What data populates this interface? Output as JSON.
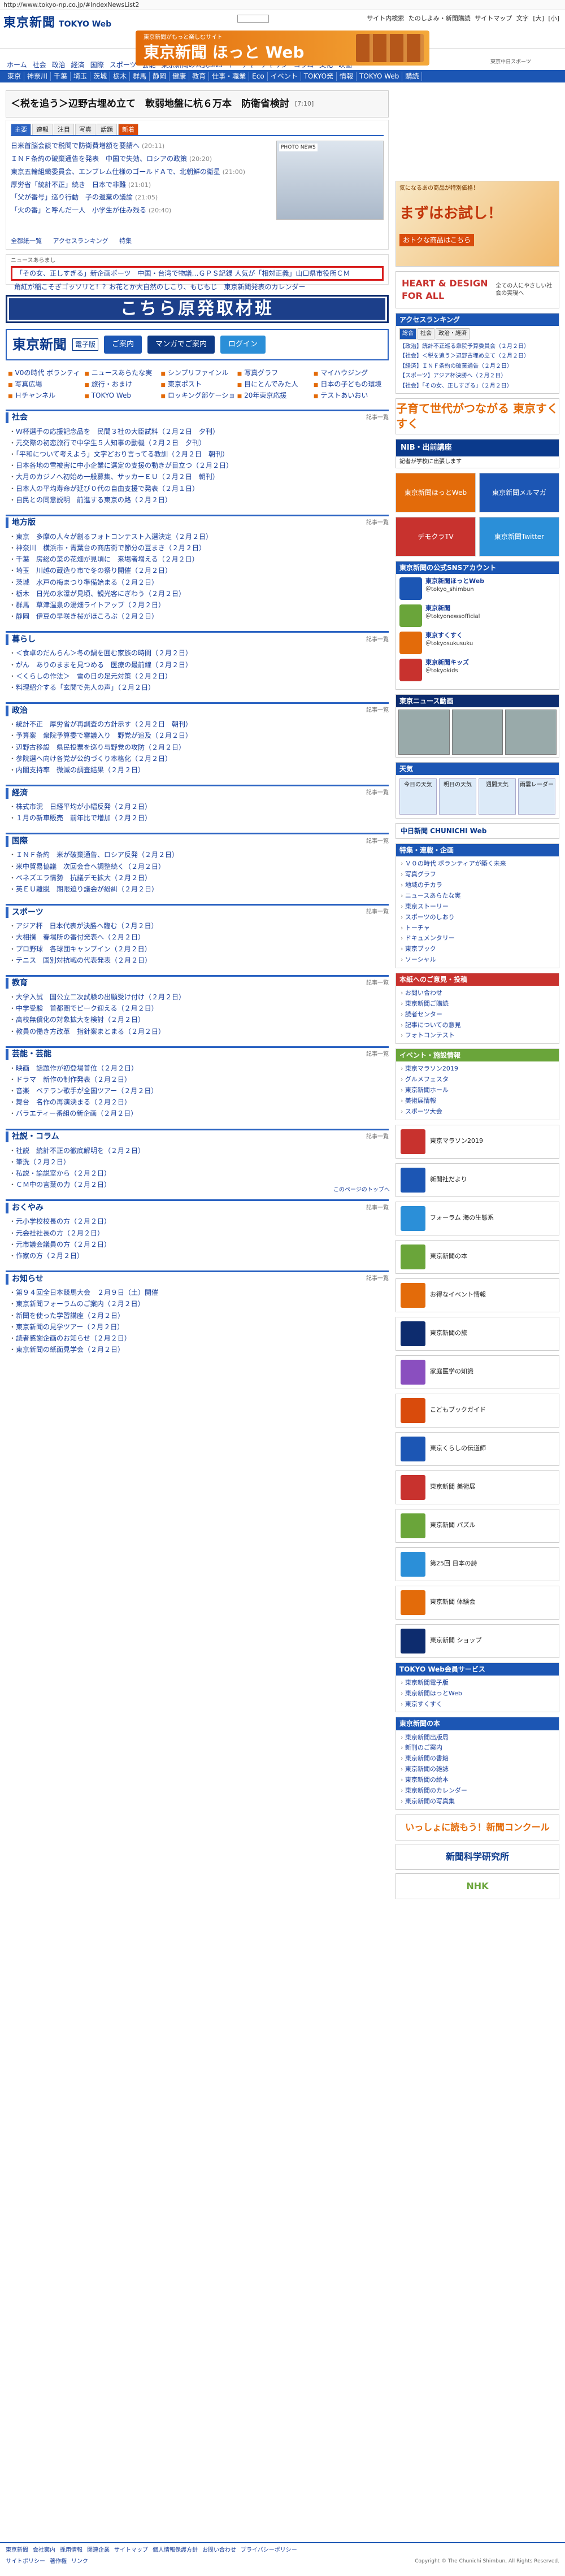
{
  "urlbar": "http://www.tokyo-np.co.jp/#IndexNewsList2",
  "header": {
    "logo": "東京新聞",
    "logo_sub": "TOKYO Web",
    "links": [
      "サイト内検索",
      "たのしよみ・新聞購読",
      "サイトマップ",
      "文字",
      "[大]",
      "[小]"
    ],
    "banner_t1": "東京新聞がもっと楽しむサイト",
    "banner_t2": "東京新聞 ほっと Web"
  },
  "nav": {
    "row1": [
      "ホーム",
      "社会",
      "政治",
      "経済",
      "国際",
      "スポーツ",
      "芸能",
      "東京新聞の公式SNS",
      "トーチャ",
      "チャリン",
      "コラム",
      "文化",
      "映画"
    ],
    "row2": [
      "東京",
      "神奈川",
      "千葉",
      "埼玉",
      "茨城",
      "栃木",
      "群馬",
      "静岡",
      "健康",
      "教育",
      "仕事・職業",
      "Eco",
      "イベント",
      "TOKYO発",
      "情報",
      "TOKYO Web",
      "購読"
    ],
    "ad": "東京中日スポーツ"
  },
  "headline": {
    "text": "＜税を追う＞辺野古埋め立て　軟弱地盤に杭６万本　防衛省検討",
    "time": "[7:10]"
  },
  "news": {
    "tabs": [
      "主要",
      "速報",
      "注目",
      "写真",
      "話題",
      "新着"
    ],
    "items": [
      {
        "t": "日米首脳会談で税関で防衛費増額を要請へ",
        "d": "(20:11)"
      },
      {
        "t": "ＩＮＦ条約の破棄通告を発表　中国で失効、ロシアの政策",
        "d": "(20:20)"
      },
      {
        "t": "東京五輪組織委員会、エンブレム仕様のゴールドＡで、北朝鮮の衛星",
        "d": "(21:00)"
      },
      {
        "t": "厚労省「統計不正」続き　日本で非難",
        "d": "(21:01)"
      },
      {
        "t": "「父が番号」巡り行動　子の遺棄の議論",
        "d": "(21:05)"
      },
      {
        "t": "「火の番」と呼んだ一人　小学生が住み残る",
        "d": "(20:40)"
      }
    ],
    "photo_caption": "PHOTO NEWS",
    "links": [
      "全都紙一覧",
      "アクセスランキング",
      "特集"
    ],
    "ticker_label": "ニュースあらまし",
    "ticker_item": "「その女、正しすぎる」新企画ポーツ　中国・台湾で物議…ＧＰＳ記録 人気が「相対正義」山口県市役所ＣＭ",
    "ticker_item2": "角紅が稲こそぎゴッソリと！？お花とか大自然のしこり、もじもじ　東京新聞発表のカレンダー"
  },
  "kochira": "こちら原発取材班",
  "denshi": {
    "logo": "東京新聞",
    "ep": "電子版",
    "btn1": "ご案内",
    "btn2": "マンガでご案内",
    "btn3": "ログイン"
  },
  "services": [
    "V0の時代 ボランティアが築く未来",
    "ニュースあらたな実",
    "シンプリファインル",
    "写真グラフ",
    "マイハウジング",
    "写真広場",
    "旅行・おまけ",
    "東京ポスト",
    "目にとんでみた人",
    "日本の子どもの環境",
    "Ｈチャンネル",
    "TOKYO Web",
    "ロッキング部ケーション",
    "20年東京応援",
    "テストあいおい"
  ],
  "sections": [
    {
      "title": "社会",
      "more": "記事一覧",
      "items": [
        "Ｗ杯選手の応援記念品を　民間３社の大臣試料（２月２日　夕刊）",
        "元交際の初恋旅行で中学生５人知事の動機（２月２日　夕刊）",
        "「平和について考えよう」文字どおり言ってる教訓（２月２日　朝刊）",
        "日本各地の雪被害に中小企業に選定の支援の動きが目立つ（２月２日）",
        "大月のカジノへ初始め一般募集、サッカーＥＵ（２月２日　朝刊）",
        "日本人の平均寿命が延び０代の自由支援で発表（２月１日）",
        "自民との同意説明　前進する東京の路（２月２日）"
      ]
    },
    {
      "title": "地方版",
      "more": "記事一覧",
      "items": [
        "東京　多摩の人々が創るフォトコンテスト入選決定（２月２日）",
        "神奈川　横浜市・青葉台の商店街で節分の豆まき（２月２日）",
        "千葉　房総の菜の花畑が見頃に　来場者増える（２月２日）",
        "埼玉　川越の蔵造り市で冬の祭り開催（２月２日）",
        "茨城　水戸の梅まつり準備始まる（２月２日）",
        "栃木　日光の氷瀑が見頃、観光客にぎわう（２月２日）",
        "群馬　草津温泉の湯畑ライトアップ（２月２日）",
        "静岡　伊豆の早咲き桜がほころぶ（２月２日）"
      ]
    },
    {
      "title": "暮らし",
      "more": "記事一覧",
      "items": [
        "＜食卓のだんらん＞冬の鍋を囲む家族の時間（２月２日）",
        "がん　ありのままを見つめる　医療の最前線（２月２日）",
        "＜くらしの作法＞　雪の日の足元対策（２月２日）",
        "料理紹介する「玄関で先人の声」（２月２日）"
      ]
    },
    {
      "title": "政治",
      "more": "記事一覧",
      "items": [
        "統計不正　厚労省が再調査の方針示す（２月２日　朝刊）",
        "予算案　衆院予算委で審議入り　野党が追及（２月２日）",
        "辺野古移設　県民投票を巡り与野党の攻防（２月２日）",
        "参院選へ向け各党が公約づくり本格化（２月２日）",
        "内閣支持率　微減の調査結果（２月２日）"
      ]
    },
    {
      "title": "経済",
      "more": "記事一覧",
      "items": [
        "株式市況　日経平均が小幅反発（２月２日）",
        "１月の新車販売　前年比で増加（２月２日）"
      ]
    },
    {
      "title": "国際",
      "more": "記事一覧",
      "items": [
        "ＩＮＦ条約　米が破棄通告、ロシア反発（２月２日）",
        "米中貿易協議　次回会合へ調整続く（２月２日）",
        "ベネズエラ情勢　抗議デモ拡大（２月２日）",
        "英ＥＵ離脱　期限迫り議会が紛糾（２月２日）"
      ]
    },
    {
      "title": "スポーツ",
      "more": "記事一覧",
      "items": [
        "アジア杯　日本代表が決勝へ臨む（２月２日）",
        "大相撲　春場所の番付発表へ（２月２日）",
        "プロ野球　各球団キャンプイン（２月２日）",
        "テニス　国別対抗戦の代表発表（２月２日）"
      ]
    },
    {
      "title": "教育",
      "more": "記事一覧",
      "items": [
        "大学入試　国公立二次試験の出願受け付け（２月２日）",
        "中学受験　首都圏でピーク迎える（２月２日）",
        "高校無償化の対象拡大を検討（２月２日）",
        "教員の働き方改革　指針案まとまる（２月２日）"
      ]
    },
    {
      "title": "芸能・芸能",
      "more": "記事一覧",
      "items": [
        "映画　話題作が初登場首位（２月２日）",
        "ドラマ　新作の制作発表（２月２日）",
        "音楽　ベテラン歌手が全国ツアー（２月２日）",
        "舞台　名作の再演決まる（２月２日）",
        "バラエティー番組の新企画（２月２日）"
      ]
    },
    {
      "title": "社説・コラム",
      "more": "記事一覧",
      "items": [
        "社説　統計不正の徹底解明を（２月２日）",
        "筆洗（２月２日）",
        "私説・論説室から（２月２日）",
        "ＣＭ中の言葉の力（２月２日）"
      ]
    },
    {
      "title": "おくやみ",
      "more": "記事一覧",
      "items": [
        "元小学校校長の方（２月２日）",
        "元会社社長の方（２月２日）",
        "元市議会議員の方（２月２日）",
        "作家の方（２月２日）"
      ]
    },
    {
      "title": "お知らせ",
      "more": "記事一覧",
      "items": [
        "第９４回全日本競馬大会　２月９日（土）開催",
        "東京新聞フォーラムのご案内（２月２日）",
        "新聞を使った学習講座（２月２日）",
        "東京新聞の見学ツアー（２月２日）",
        "読者感謝企画のお知らせ（２月２日）",
        "東京新聞の紙面見学会（２月２日）"
      ]
    }
  ],
  "side": {
    "ad_t": "気になるあの商品が特別価格！",
    "ad_big": "まずはお試し！",
    "ad_sub": "おトクな商品はこちら",
    "heart_t": "HEART & DESIGN FOR ALL",
    "heart_sub": "全ての人にやさしい社会の実現へ",
    "rank_title": "アクセスランキング",
    "rank_tabs": [
      "総合",
      "社会",
      "政治・経済"
    ],
    "rank_items": [
      "【政治】統計不正巡る衆院予算委員会（２月２日）",
      "【社会】＜税を追う＞辺野古埋め立て（２月２日）",
      "【経済】ＩＮＦ条約の破棄通告（２月２日）",
      "【スポーツ】アジア杯決勝へ（２月２日）",
      "【社会】「その女、正しすぎる」（２月２日）"
    ],
    "suku": "子育て世代がつながる 東京すくすく",
    "nib": "NIB・出前講座",
    "nib_sub": "記者が学校に出張します",
    "hot": "東京新聞ほっとWeb",
    "mail": "東京新聞メルマガ",
    "dcv": "デモクラTV",
    "dcv2": "東京新聞Twitter",
    "sns_title": "東京新聞の公式SNSアカウント",
    "sns": [
      {
        "n": "東京新聞ほっとWeb",
        "d": "＠tokyo_shimbun"
      },
      {
        "n": "東京新聞",
        "d": "＠tokyonewsofficial"
      },
      {
        "n": "東京すくすく",
        "d": "＠tokyosukusuku"
      },
      {
        "n": "東京新聞キッズ",
        "d": "＠tokyokids"
      }
    ],
    "tv_title": "東京ニュース動画",
    "weather_title": "天気",
    "weather": [
      "今日の天気",
      "明日の天気",
      "週間天気",
      "雨雲レーダー"
    ],
    "chunichi": "中日新聞 CHUNICHI Web",
    "list1_title": "特集・連載・企画",
    "list1": [
      "Ｖ０の時代 ボランティアが築く未来",
      "写真グラフ",
      "地域のチカラ",
      "ニュースあらたな実",
      "東京ストーリー",
      "スポーツのしおり",
      "トーチャ",
      "ドキュメンタリー",
      "東京ブック",
      "ソーシャル"
    ],
    "list2_title": "本紙へのご意見・投稿",
    "list2": [
      "お問い合わせ",
      "東京新聞ご購読",
      "読者センター",
      "記事についての意見",
      "フォトコンテスト"
    ],
    "list3_title": "イベント・施設情報",
    "list3": [
      "東京マラソン2019",
      "グルメフェスタ",
      "東京新聞ホール",
      "美術展情報",
      "スポーツ大会"
    ],
    "ads": [
      {
        "t": "東京マラソン2019",
        "c": "#c8322e"
      },
      {
        "t": "新聞社だより",
        "c": "#1c56b4"
      },
      {
        "t": "フォーラム 海の生態系",
        "c": "#2b8fd8"
      },
      {
        "t": "東京新聞の本",
        "c": "#6aa53a"
      },
      {
        "t": "お得なイベント情報",
        "c": "#e36b0a"
      },
      {
        "t": "東京新聞の旅",
        "c": "#0d2c6e"
      },
      {
        "t": "家庭医学の知識",
        "c": "#8a4fbf"
      },
      {
        "t": "こどもブックガイド",
        "c": "#d94b0c"
      },
      {
        "t": "東京くらしの伝道師",
        "c": "#1c56b4"
      },
      {
        "t": "東京新聞 美術展",
        "c": "#c8322e"
      },
      {
        "t": "東京新聞 パズル",
        "c": "#6aa53a"
      },
      {
        "t": "第25回 日本の詩",
        "c": "#2b8fd8"
      },
      {
        "t": "東京新聞 体験会",
        "c": "#e36b0a"
      },
      {
        "t": "東京新聞 ショップ",
        "c": "#0d2c6e"
      }
    ],
    "list4_title": "TOKYO Web会員サービス",
    "list4": [
      "東京新聞電子版",
      "東京新聞ほっとWeb",
      "東京すくすく"
    ],
    "list5_title": "東京新聞の本",
    "list5": [
      "東京新聞出版局",
      "新刊のご案内",
      "東京新聞の書籍",
      "東京新聞の雑誌",
      "東京新聞の絵本",
      "東京新聞のカレンダー",
      "東京新聞の写真集"
    ],
    "bigads": [
      "いっしょに読もう！新聞コンクール",
      "新聞科学研究所",
      "NHK"
    ]
  },
  "toTop": "このページのトップへ",
  "footer": {
    "links": [
      "東京新聞",
      "会社案内",
      "採用情報",
      "関連企業",
      "サイトマップ",
      "個人情報保護方針",
      "お問い合わせ",
      "プライバシーポリシー"
    ],
    "links2": [
      "サイトポリシー",
      "著作権",
      "リンク"
    ],
    "copyright": "Copyright © The Chunichi Shimbun, All Rights Reserved."
  }
}
